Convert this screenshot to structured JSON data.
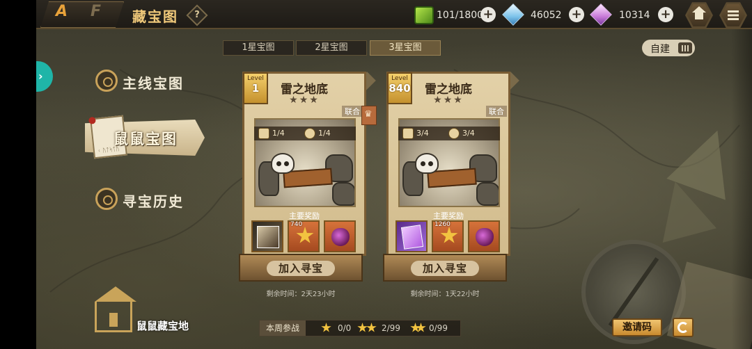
{
  "header": {
    "logo_main": "A",
    "logo_secondary": "F",
    "title": "藏宝图",
    "help": "?",
    "resources": [
      {
        "name": "stamina",
        "value": "101/1800",
        "icon": "stamina-cube-icon"
      },
      {
        "name": "crystal",
        "value": "46052",
        "icon": "blue-crystal-icon"
      },
      {
        "name": "gem",
        "value": "10314",
        "icon": "purple-gem-icon"
      }
    ],
    "plus": "+"
  },
  "side_tab": {
    "arrow": "›"
  },
  "star_tabs": [
    {
      "label": "1星宝图",
      "active": false
    },
    {
      "label": "2星宝图",
      "active": false
    },
    {
      "label": "3星宝图",
      "active": true
    }
  ],
  "self_build": {
    "label": "自建"
  },
  "nav": {
    "main_map": "主线宝图",
    "rat_map": "鼠鼠宝图",
    "rat_doc_text": "ᚲ ᚢᛏᛋᛏᚢ",
    "history": "寻宝历史"
  },
  "cards": [
    {
      "level_label": "Level",
      "level": "1",
      "name": "雷之地底",
      "stars": "★★★",
      "tag": "联合",
      "counter_a": "1/4",
      "counter_b": "1/4",
      "main_reward_label": "主要奖励",
      "rewards": [
        {
          "type": "picture-card",
          "count": ""
        },
        {
          "type": "gold-star",
          "count": "740"
        },
        {
          "type": "purple-heart",
          "count": ""
        }
      ],
      "join_label": "加入寻宝",
      "remaining": "剩余时间：2天23小时"
    },
    {
      "level_label": "Level",
      "level": "840",
      "name": "雷之地底",
      "stars": "★★★",
      "tag": "联合",
      "counter_a": "3/4",
      "counter_b": "3/4",
      "main_reward_label": "主要奖励",
      "rewards": [
        {
          "type": "purple-ticket",
          "count": ""
        },
        {
          "type": "gold-star",
          "count": "1260"
        },
        {
          "type": "purple-heart",
          "count": ""
        }
      ],
      "join_label": "加入寻宝",
      "remaining": "剩余时间：1天22小时"
    }
  ],
  "bottom": {
    "treasure_home": "鼠鼠藏宝地",
    "week_label": "本周参战",
    "week_counts": [
      "0/0",
      "2/99",
      "0/99"
    ],
    "invite_label": "邀请码"
  },
  "colors": {
    "accent_gold": "#e8a23a",
    "title_gold": "#f0c97a",
    "teal_tab": "#1fb5a8",
    "card_parchment": "#e3d1a8"
  }
}
